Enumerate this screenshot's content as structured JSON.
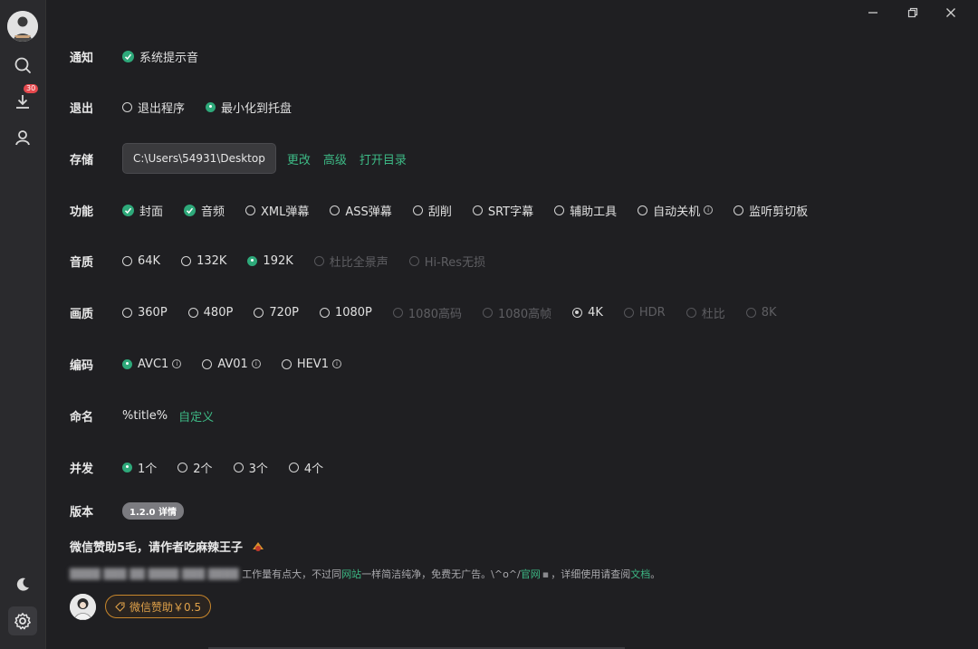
{
  "sidebar": {
    "download_badge": "30"
  },
  "settings": {
    "notify": {
      "label": "通知",
      "option": "系统提示音"
    },
    "exit": {
      "label": "退出",
      "options": [
        "退出程序",
        "最小化到托盘"
      ]
    },
    "storage": {
      "label": "存储",
      "path": "C:\\Users\\54931\\Desktop",
      "links": [
        "更改",
        "高级",
        "打开目录"
      ]
    },
    "features": {
      "label": "功能",
      "options": [
        "封面",
        "音频",
        "XML弹幕",
        "ASS弹幕",
        "刮削",
        "SRT字幕",
        "辅助工具",
        "自动关机",
        "监听剪切板"
      ]
    },
    "audio": {
      "label": "音质",
      "options": [
        "64K",
        "132K",
        "192K",
        "杜比全景声",
        "Hi-Res无损"
      ]
    },
    "video": {
      "label": "画质",
      "options": [
        "360P",
        "480P",
        "720P",
        "1080P",
        "1080高码",
        "1080高帧",
        "4K",
        "HDR",
        "杜比",
        "8K"
      ]
    },
    "codec": {
      "label": "编码",
      "options": [
        "AVC1",
        "AV01",
        "HEV1"
      ]
    },
    "naming": {
      "label": "命名",
      "value": "%title%",
      "link": "自定义"
    },
    "concurrency": {
      "label": "并发",
      "options": [
        "1个",
        "2个",
        "3个",
        "4个"
      ]
    },
    "version": {
      "label": "版本",
      "value": "1.2.0 详情"
    }
  },
  "donate": {
    "title": "微信赞助5毛，请作者吃麻辣王子",
    "desc_part1": "工作量有点大，不过同",
    "desc_link1": "网站",
    "desc_part2": "一样简洁纯净，免费无广告。\\^o^/",
    "desc_link2": "官网",
    "desc_part3": "，详细使用请查阅",
    "desc_link3": "文档",
    "desc_end": "。",
    "button": "微信赞助￥0.5"
  },
  "colors": {
    "accent": "#2ea97a",
    "background": "#1f1f22",
    "donate": "#e0a24a"
  }
}
